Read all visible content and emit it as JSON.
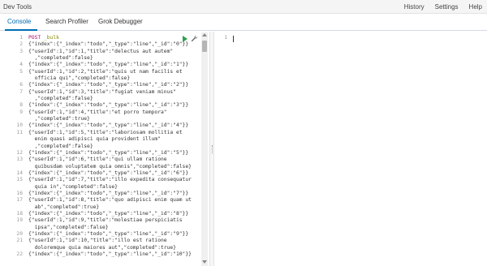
{
  "app": {
    "title": "Dev Tools",
    "menu": [
      "History",
      "Settings",
      "Help"
    ]
  },
  "tabs": [
    {
      "label": "Console",
      "active": true
    },
    {
      "label": "Search Profiler",
      "active": false
    },
    {
      "label": "Grok Debugger",
      "active": false
    }
  ],
  "editor": {
    "request_method": "POST",
    "request_path": "_bulk",
    "lines": [
      {
        "n": "1",
        "text": "POST _bulk"
      },
      {
        "n": "2",
        "text": "{\"index\":{\"_index\":\"todo\",\"_type\":\"line\",\"_id\":\"0\"}}"
      },
      {
        "n": "3",
        "text": "{\"userId\":1,\"id\":1,\"title\":\"delectus aut autem\""
      },
      {
        "n": "",
        "text": "  ,\"completed\":false}"
      },
      {
        "n": "4",
        "text": "{\"index\":{\"_index\":\"todo\",\"_type\":\"line\",\"_id\":\"1\"}}"
      },
      {
        "n": "5",
        "text": "{\"userId\":1,\"id\":2,\"title\":\"quis ut nam facilis et"
      },
      {
        "n": "",
        "text": "  officia qui\",\"completed\":false}"
      },
      {
        "n": "6",
        "text": "{\"index\":{\"_index\":\"todo\",\"_type\":\"line\",\"_id\":\"2\"}}"
      },
      {
        "n": "7",
        "text": "{\"userId\":1,\"id\":3,\"title\":\"fugiat veniam minus\""
      },
      {
        "n": "",
        "text": "  ,\"completed\":false}"
      },
      {
        "n": "8",
        "text": "{\"index\":{\"_index\":\"todo\",\"_type\":\"line\",\"_id\":\"3\"}}"
      },
      {
        "n": "9",
        "text": "{\"userId\":1,\"id\":4,\"title\":\"et porro tempora\""
      },
      {
        "n": "",
        "text": "  ,\"completed\":true}"
      },
      {
        "n": "10",
        "text": "{\"index\":{\"_index\":\"todo\",\"_type\":\"line\",\"_id\":\"4\"}}"
      },
      {
        "n": "11",
        "text": "{\"userId\":1,\"id\":5,\"title\":\"laboriosam mollitia et"
      },
      {
        "n": "",
        "text": "  enim quasi adipisci quia provident illum\""
      },
      {
        "n": "",
        "text": "  ,\"completed\":false}"
      },
      {
        "n": "12",
        "text": "{\"index\":{\"_index\":\"todo\",\"_type\":\"line\",\"_id\":\"5\"}}"
      },
      {
        "n": "13",
        "text": "{\"userId\":1,\"id\":6,\"title\":\"qui ullam ratione"
      },
      {
        "n": "",
        "text": "  quibusdam voluptatem quia omnis\",\"completed\":false}"
      },
      {
        "n": "14",
        "text": "{\"index\":{\"_index\":\"todo\",\"_type\":\"line\",\"_id\":\"6\"}}"
      },
      {
        "n": "15",
        "text": "{\"userId\":1,\"id\":7,\"title\":\"illo expedita consequatur"
      },
      {
        "n": "",
        "text": "  quia in\",\"completed\":false}"
      },
      {
        "n": "16",
        "text": "{\"index\":{\"_index\":\"todo\",\"_type\":\"line\",\"_id\":\"7\"}}"
      },
      {
        "n": "17",
        "text": "{\"userId\":1,\"id\":8,\"title\":\"quo adipisci enim quam ut"
      },
      {
        "n": "",
        "text": "  ab\",\"completed\":true}"
      },
      {
        "n": "18",
        "text": "{\"index\":{\"_index\":\"todo\",\"_type\":\"line\",\"_id\":\"8\"}}"
      },
      {
        "n": "19",
        "text": "{\"userId\":1,\"id\":9,\"title\":\"molestiae perspiciatis"
      },
      {
        "n": "",
        "text": "  ipsa\",\"completed\":false}"
      },
      {
        "n": "20",
        "text": "{\"index\":{\"_index\":\"todo\",\"_type\":\"line\",\"_id\":\"9\"}}"
      },
      {
        "n": "21",
        "text": "{\"userId\":1,\"id\":10,\"title\":\"illo est ratione"
      },
      {
        "n": "",
        "text": "  doloremque quia maiores aut\",\"completed\":true}"
      },
      {
        "n": "22",
        "text": "{\"index\":{\"_index\":\"todo\",\"_type\":\"line\",\"_id\":\"10\"}}"
      }
    ]
  },
  "output": {
    "line_number": "1"
  },
  "icons": {
    "run": "play-icon",
    "settings": "wrench-icon"
  },
  "colors": {
    "accent": "#006bb4",
    "run": "#2d9f4e"
  }
}
